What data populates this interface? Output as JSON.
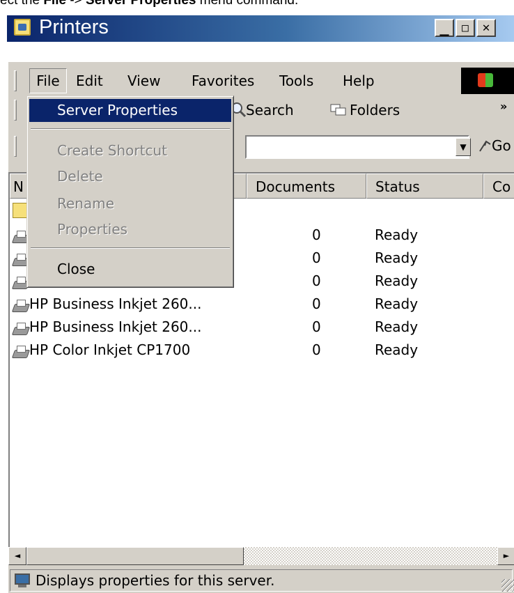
{
  "instruction": {
    "prefix": "ect the ",
    "file": "File",
    "arrow": " -> ",
    "server_props": "Server Properties",
    "suffix": " menu command."
  },
  "window": {
    "title": "Printers"
  },
  "caption_buttons": {
    "minimize": "_",
    "maximize": "□",
    "close": "✕"
  },
  "menubar": [
    "File",
    "Edit",
    "View",
    "Favorites",
    "Tools",
    "Help"
  ],
  "toolbar": {
    "search": "Search",
    "folders": "Folders",
    "chevrons": "»"
  },
  "address": {
    "go": "Go",
    "dropdown": "▼"
  },
  "columns": {
    "name": "N",
    "documents": "Documents",
    "status": "Status",
    "comments": "Co"
  },
  "printers": [
    {
      "name": "",
      "documents": "0",
      "status": "Ready"
    },
    {
      "name": "",
      "documents": "0",
      "status": "Ready"
    },
    {
      "name": "",
      "documents": "0",
      "status": "Ready"
    },
    {
      "name": "HP Business Inkjet 260...",
      "documents": "0",
      "status": "Ready"
    },
    {
      "name": "HP Business Inkjet 260...",
      "documents": "0",
      "status": "Ready"
    },
    {
      "name": "HP Color Inkjet CP1700",
      "documents": "0",
      "status": "Ready"
    }
  ],
  "file_menu": {
    "server_properties": "Server Properties",
    "create_shortcut": "Create Shortcut",
    "delete": "Delete",
    "rename": "Rename",
    "properties": "Properties",
    "close": "Close"
  },
  "scrollbar": {
    "left": "◄",
    "right": "►"
  },
  "status": {
    "text": "Displays properties for this server."
  },
  "colors": {
    "title_start": "#0a246a",
    "title_end": "#a6caf0",
    "highlight": "#0a246a",
    "face": "#d4d0c8"
  }
}
